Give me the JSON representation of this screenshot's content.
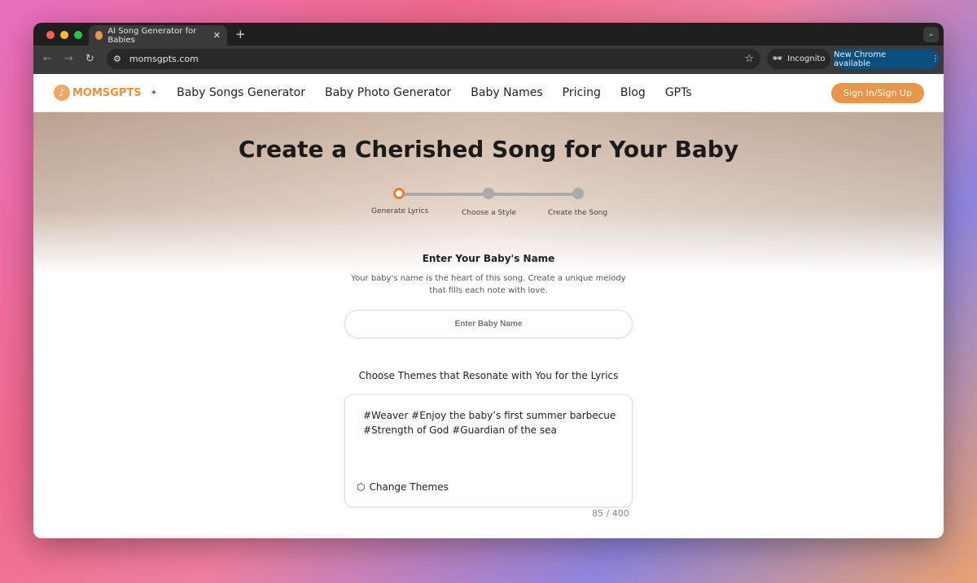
{
  "browser": {
    "tab_title": "AI Song Generator for Babies",
    "url": "momsgpts.com",
    "incognito": "Incognito",
    "new_chrome": "New Chrome available"
  },
  "header": {
    "logo": "MOMSGPTS",
    "menu": [
      "Baby Songs Generator",
      "Baby Photo Generator",
      "Baby Names",
      "Pricing",
      "Blog",
      "GPTs"
    ],
    "signin": "Sign In/Sign Up"
  },
  "main": {
    "title": "Create a Cherished Song for Your Baby",
    "steps": [
      "Generate Lyrics",
      "Choose a Style",
      "Create the Song"
    ],
    "name_heading": "Enter Your Baby's Name",
    "name_desc": "Your baby's name is the heart of this song. Create a unique melody that fills each note with love.",
    "name_placeholder": "Enter Baby Name",
    "themes_heading": "Choose Themes that Resonate with You for the Lyrics",
    "themes_text": "#Weaver #Enjoy the baby’s first summer barbecue #Strength of God #Guardian of the sea",
    "change_themes": "Change Themes",
    "char_count": "85 / 400"
  },
  "colors": {
    "accent": "#e8964a",
    "step_active": "#f07a30"
  }
}
